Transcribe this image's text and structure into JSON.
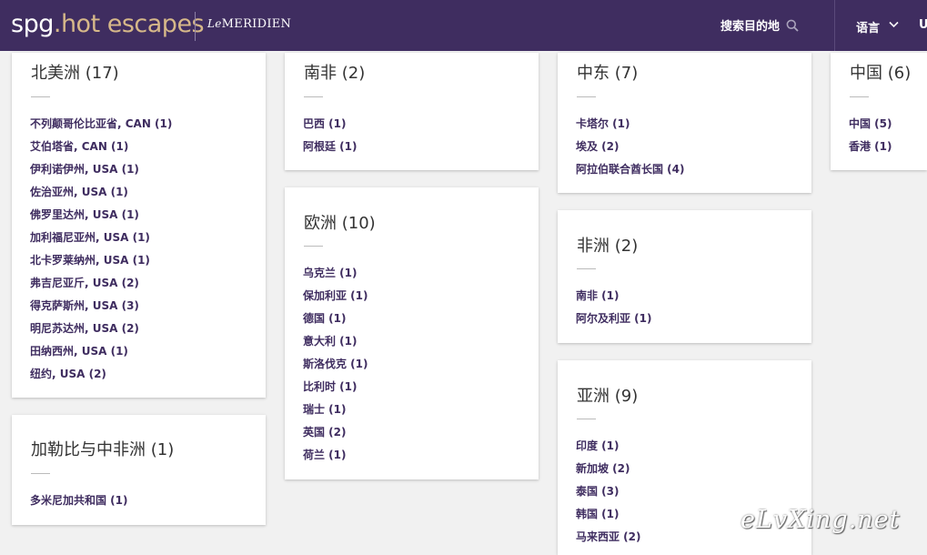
{
  "header": {
    "logo_spg": "spg",
    "logo_rest": ".hot escapes",
    "brand_le": "Le",
    "brand_name": "MERIDIEN",
    "search_label": "搜索目的地",
    "language_label": "语言",
    "user_initial": "U"
  },
  "regions": [
    {
      "title": "北美洲 (17)",
      "items": [
        "不列颠哥伦比亚省, CAN (1)",
        "艾伯塔省, CAN (1)",
        "伊利诺伊州, USA (1)",
        "佐治亚州, USA (1)",
        "佛罗里达州, USA (1)",
        "加利福尼亚州, USA (1)",
        "北卡罗莱纳州, USA (1)",
        "弗吉尼亚斤, USA (2)",
        "得克萨斯州, USA (3)",
        "明尼苏达州, USA (2)",
        "田纳西州, USA (1)",
        "纽约, USA (2)"
      ]
    },
    {
      "title": "加勒比与中非洲 (1)",
      "items": [
        "多米尼加共和国 (1)"
      ]
    },
    {
      "title": "南非 (2)",
      "items": [
        "巴西 (1)",
        "阿根廷 (1)"
      ]
    },
    {
      "title": "欧洲 (10)",
      "items": [
        "乌克兰 (1)",
        "保加利亚 (1)",
        "德国 (1)",
        "意大利 (1)",
        "斯洛伐克 (1)",
        "比利时 (1)",
        "瑞士 (1)",
        "英国 (2)",
        "荷兰 (1)"
      ]
    },
    {
      "title": "中东 (7)",
      "items": [
        "卡塔尔 (1)",
        "埃及 (2)",
        "阿拉伯联合酋长国 (4)"
      ]
    },
    {
      "title": "非洲 (2)",
      "items": [
        "南非 (1)",
        "阿尔及利亚 (1)"
      ]
    },
    {
      "title": "亚洲 (9)",
      "items": [
        "印度 (1)",
        "新加坡 (2)",
        "泰国 (3)",
        "韩国 (1)",
        "马来西亚 (2)"
      ]
    },
    {
      "title": "中国 (6)",
      "items": [
        "中国 (5)",
        "香港 (1)"
      ]
    }
  ],
  "watermark": "eLvXing.net",
  "colors": {
    "header_bg": "#3f2d60",
    "link": "#3f2d60",
    "logo_accent": "#d6b889",
    "page_bg": "#f1f1f1"
  }
}
